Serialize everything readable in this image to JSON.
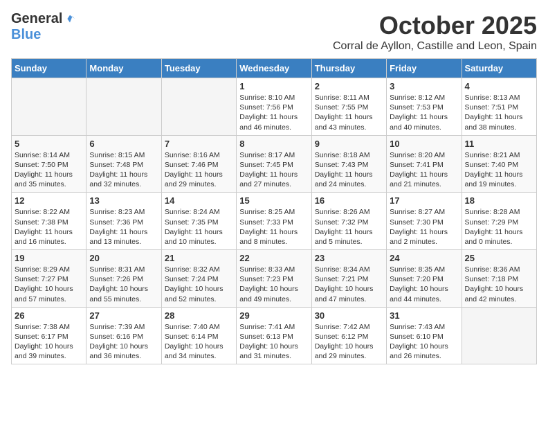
{
  "logo": {
    "general": "General",
    "blue": "Blue"
  },
  "title": "October 2025",
  "subtitle": "Corral de Ayllon, Castille and Leon, Spain",
  "weekdays": [
    "Sunday",
    "Monday",
    "Tuesday",
    "Wednesday",
    "Thursday",
    "Friday",
    "Saturday"
  ],
  "weeks": [
    [
      {
        "day": "",
        "info": ""
      },
      {
        "day": "",
        "info": ""
      },
      {
        "day": "",
        "info": ""
      },
      {
        "day": "1",
        "info": "Sunrise: 8:10 AM\nSunset: 7:56 PM\nDaylight: 11 hours and 46 minutes."
      },
      {
        "day": "2",
        "info": "Sunrise: 8:11 AM\nSunset: 7:55 PM\nDaylight: 11 hours and 43 minutes."
      },
      {
        "day": "3",
        "info": "Sunrise: 8:12 AM\nSunset: 7:53 PM\nDaylight: 11 hours and 40 minutes."
      },
      {
        "day": "4",
        "info": "Sunrise: 8:13 AM\nSunset: 7:51 PM\nDaylight: 11 hours and 38 minutes."
      }
    ],
    [
      {
        "day": "5",
        "info": "Sunrise: 8:14 AM\nSunset: 7:50 PM\nDaylight: 11 hours and 35 minutes."
      },
      {
        "day": "6",
        "info": "Sunrise: 8:15 AM\nSunset: 7:48 PM\nDaylight: 11 hours and 32 minutes."
      },
      {
        "day": "7",
        "info": "Sunrise: 8:16 AM\nSunset: 7:46 PM\nDaylight: 11 hours and 29 minutes."
      },
      {
        "day": "8",
        "info": "Sunrise: 8:17 AM\nSunset: 7:45 PM\nDaylight: 11 hours and 27 minutes."
      },
      {
        "day": "9",
        "info": "Sunrise: 8:18 AM\nSunset: 7:43 PM\nDaylight: 11 hours and 24 minutes."
      },
      {
        "day": "10",
        "info": "Sunrise: 8:20 AM\nSunset: 7:41 PM\nDaylight: 11 hours and 21 minutes."
      },
      {
        "day": "11",
        "info": "Sunrise: 8:21 AM\nSunset: 7:40 PM\nDaylight: 11 hours and 19 minutes."
      }
    ],
    [
      {
        "day": "12",
        "info": "Sunrise: 8:22 AM\nSunset: 7:38 PM\nDaylight: 11 hours and 16 minutes."
      },
      {
        "day": "13",
        "info": "Sunrise: 8:23 AM\nSunset: 7:36 PM\nDaylight: 11 hours and 13 minutes."
      },
      {
        "day": "14",
        "info": "Sunrise: 8:24 AM\nSunset: 7:35 PM\nDaylight: 11 hours and 10 minutes."
      },
      {
        "day": "15",
        "info": "Sunrise: 8:25 AM\nSunset: 7:33 PM\nDaylight: 11 hours and 8 minutes."
      },
      {
        "day": "16",
        "info": "Sunrise: 8:26 AM\nSunset: 7:32 PM\nDaylight: 11 hours and 5 minutes."
      },
      {
        "day": "17",
        "info": "Sunrise: 8:27 AM\nSunset: 7:30 PM\nDaylight: 11 hours and 2 minutes."
      },
      {
        "day": "18",
        "info": "Sunrise: 8:28 AM\nSunset: 7:29 PM\nDaylight: 11 hours and 0 minutes."
      }
    ],
    [
      {
        "day": "19",
        "info": "Sunrise: 8:29 AM\nSunset: 7:27 PM\nDaylight: 10 hours and 57 minutes."
      },
      {
        "day": "20",
        "info": "Sunrise: 8:31 AM\nSunset: 7:26 PM\nDaylight: 10 hours and 55 minutes."
      },
      {
        "day": "21",
        "info": "Sunrise: 8:32 AM\nSunset: 7:24 PM\nDaylight: 10 hours and 52 minutes."
      },
      {
        "day": "22",
        "info": "Sunrise: 8:33 AM\nSunset: 7:23 PM\nDaylight: 10 hours and 49 minutes."
      },
      {
        "day": "23",
        "info": "Sunrise: 8:34 AM\nSunset: 7:21 PM\nDaylight: 10 hours and 47 minutes."
      },
      {
        "day": "24",
        "info": "Sunrise: 8:35 AM\nSunset: 7:20 PM\nDaylight: 10 hours and 44 minutes."
      },
      {
        "day": "25",
        "info": "Sunrise: 8:36 AM\nSunset: 7:18 PM\nDaylight: 10 hours and 42 minutes."
      }
    ],
    [
      {
        "day": "26",
        "info": "Sunrise: 7:38 AM\nSunset: 6:17 PM\nDaylight: 10 hours and 39 minutes."
      },
      {
        "day": "27",
        "info": "Sunrise: 7:39 AM\nSunset: 6:16 PM\nDaylight: 10 hours and 36 minutes."
      },
      {
        "day": "28",
        "info": "Sunrise: 7:40 AM\nSunset: 6:14 PM\nDaylight: 10 hours and 34 minutes."
      },
      {
        "day": "29",
        "info": "Sunrise: 7:41 AM\nSunset: 6:13 PM\nDaylight: 10 hours and 31 minutes."
      },
      {
        "day": "30",
        "info": "Sunrise: 7:42 AM\nSunset: 6:12 PM\nDaylight: 10 hours and 29 minutes."
      },
      {
        "day": "31",
        "info": "Sunrise: 7:43 AM\nSunset: 6:10 PM\nDaylight: 10 hours and 26 minutes."
      },
      {
        "day": "",
        "info": ""
      }
    ]
  ]
}
